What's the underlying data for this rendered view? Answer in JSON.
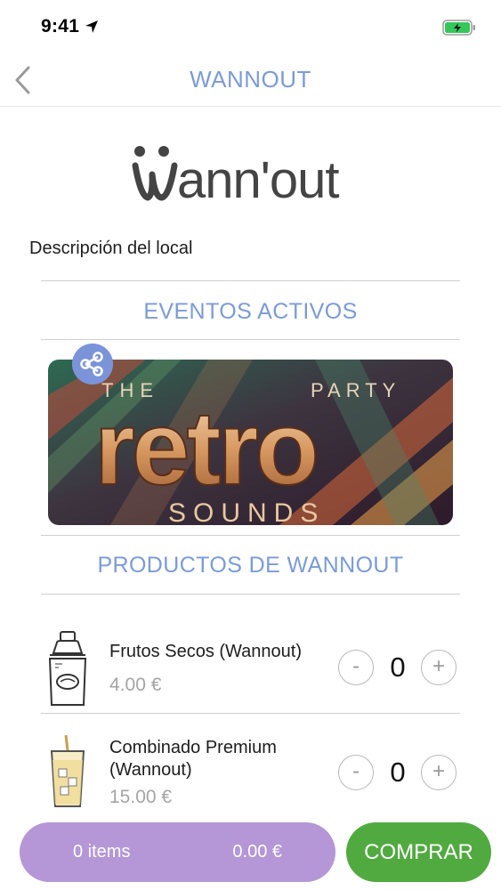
{
  "status_bar": {
    "time": "9:41"
  },
  "nav": {
    "title": "WANNOUT"
  },
  "logo": {
    "text": "Wann'out"
  },
  "venue": {
    "description": "Descripción del local"
  },
  "events": {
    "title": "EVENTOS ACTIVOS",
    "banner": {
      "line1_left": "THE",
      "line1_right": "PARTY",
      "main": "retro",
      "sub": "SOUNDS"
    }
  },
  "products": {
    "title": "PRODUCTOS DE WANNOUT",
    "items": [
      {
        "name": "Frutos Secos (Wannout)",
        "price": "4.00 €",
        "quantity": "0",
        "minus": "-",
        "plus": "+"
      },
      {
        "name": "Combinado Premium (Wannout)",
        "price": "15.00 €",
        "quantity": "0",
        "minus": "-",
        "plus": "+"
      }
    ]
  },
  "cart": {
    "items_label": "0 items",
    "total": "0.00 €",
    "buy_label": "COMPRAR"
  },
  "colors": {
    "accent": "#7b9bd6",
    "cart": "#b596d6",
    "buy": "#51aa40",
    "share": "#7b93d8"
  }
}
